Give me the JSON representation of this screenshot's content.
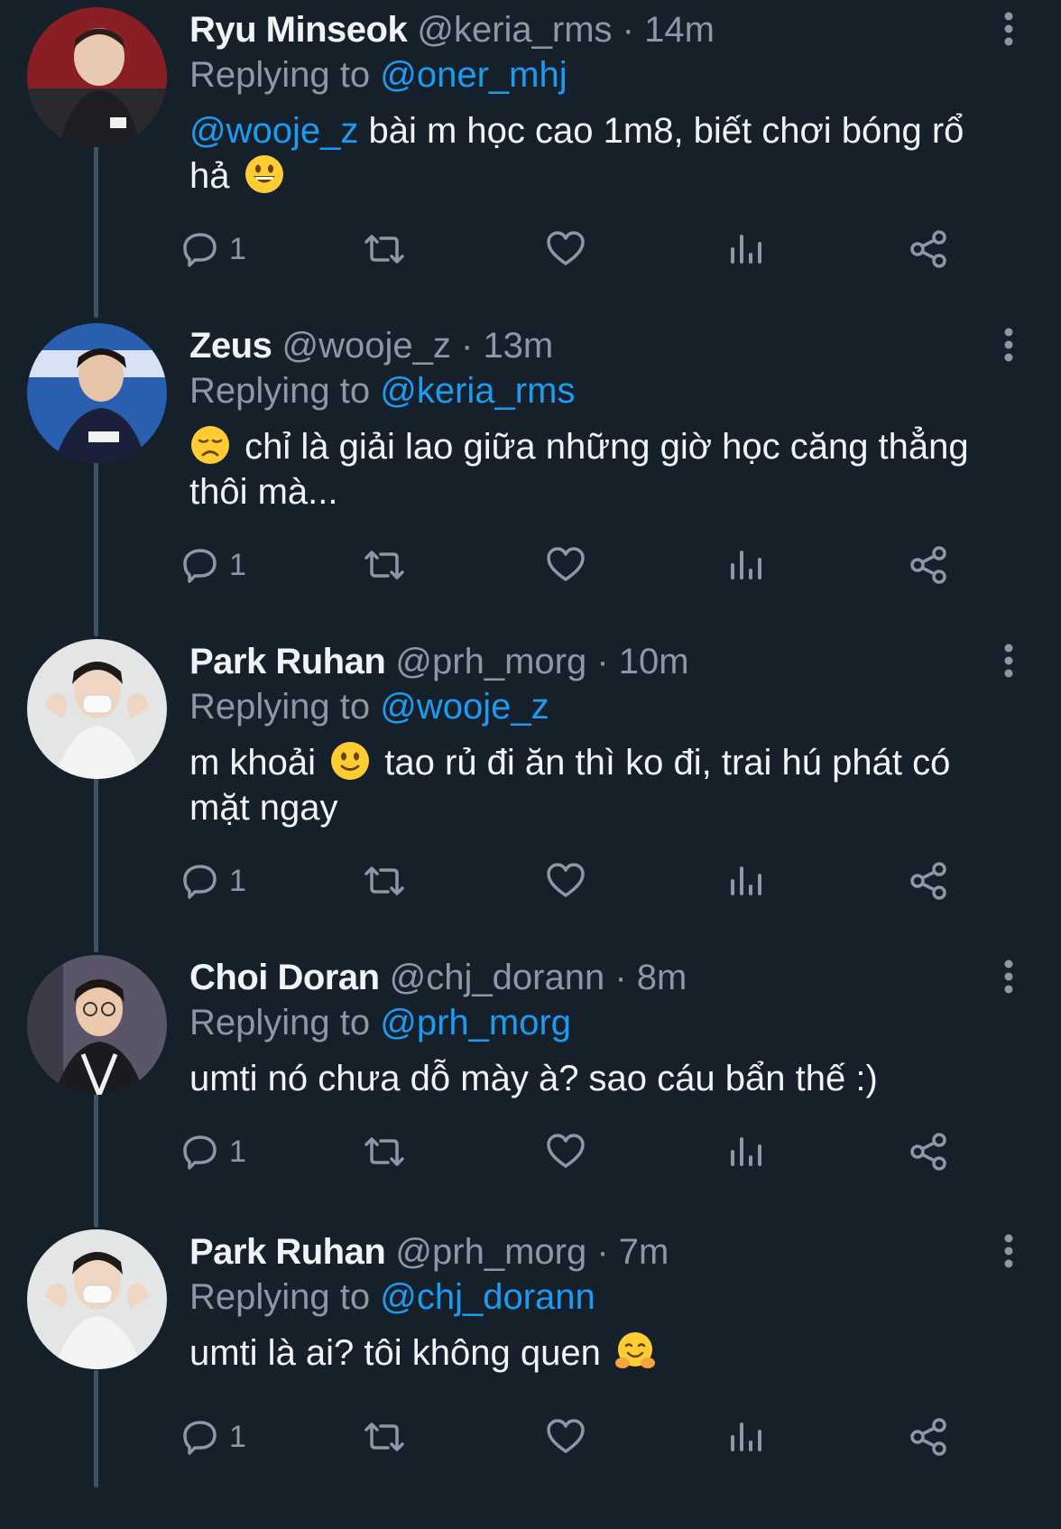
{
  "tweets": [
    {
      "name": "Ryu Minseok",
      "handle": "@keria_rms",
      "sep": "·",
      "time": "14m",
      "replying_label": "Replying to",
      "replying_to": "@oner_mhj",
      "mention": "@wooje_z",
      "text_line1": " bài m học cao 1m8, biết chơi bóng rổ",
      "text_line2": "hả",
      "emoji": "grinning-face",
      "reply_count": "1",
      "avatar_colors": [
        "#8a1e25",
        "#2a2a2e"
      ]
    },
    {
      "name": "Zeus",
      "handle": "@wooje_z",
      "sep": "·",
      "time": "13m",
      "replying_label": "Replying to",
      "replying_to": "@keria_rms",
      "text_line1": " chỉ là giải lao giữa những giờ học căng thẳng",
      "text_line2": "thôi mà...",
      "emoji": "disappointed-face",
      "reply_count": "1",
      "avatar_colors": [
        "#2a5fb0",
        "#1a1f3a"
      ]
    },
    {
      "name": "Park Ruhan",
      "handle": "@prh_morg",
      "sep": "·",
      "time": "10m",
      "replying_label": "Replying to",
      "replying_to": "@wooje_z",
      "text_pre": "m khoải ",
      "text_post": " tao rủ đi ăn thì ko đi, trai hú phát có",
      "text_line2": "mặt ngay",
      "emoji": "slightly-smiling-face",
      "reply_count": "1",
      "avatar_colors": [
        "#e3e6e4",
        "#f4f4f2"
      ]
    },
    {
      "name": "Choi Doran",
      "handle": "@chj_dorann",
      "sep": "·",
      "time": "8m",
      "replying_label": "Replying to",
      "replying_to": "@prh_morg",
      "text_line1": "umti nó chưa dỗ mày à? sao cáu bẩn thế :)",
      "reply_count": "1",
      "avatar_colors": [
        "#5a5568",
        "#1b1b1f"
      ]
    },
    {
      "name": "Park Ruhan",
      "handle": "@prh_morg",
      "sep": "·",
      "time": "7m",
      "replying_label": "Replying to",
      "replying_to": "@chj_dorann",
      "text_line1": "umti là ai? tôi không quen ",
      "emoji": "hugging-face",
      "reply_count": "1",
      "avatar_colors": [
        "#e3e6e4",
        "#f4f4f2"
      ]
    }
  ],
  "icons": {
    "reply": "speech-bubble-icon",
    "retweet": "retweet-icon",
    "like": "heart-icon",
    "views": "bar-chart-icon",
    "share": "share-icon",
    "more": "vertical-ellipsis-icon"
  },
  "colors": {
    "background": "#15202b",
    "mention": "#1d9bf0",
    "secondary_text": "#8b98a5",
    "thread_line": "#3d5466"
  }
}
